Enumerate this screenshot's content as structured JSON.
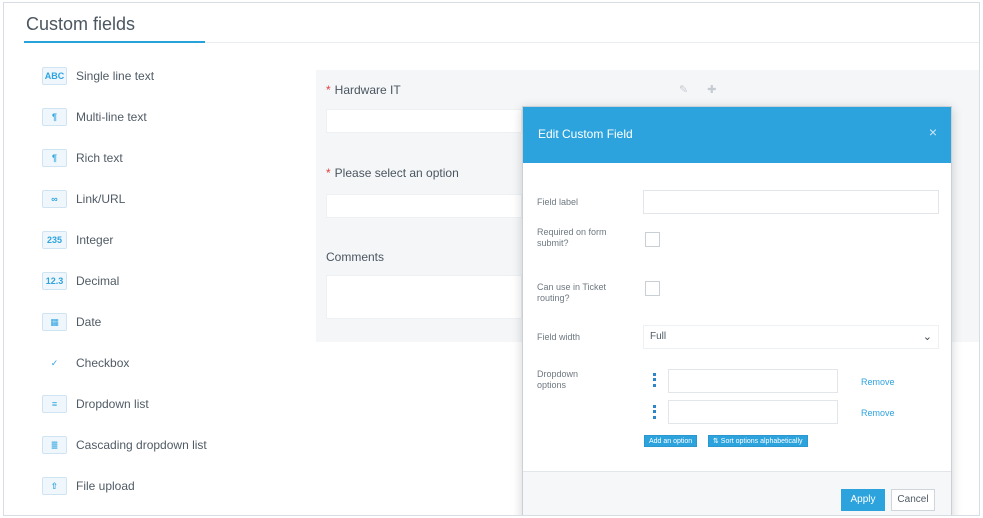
{
  "header": {
    "title": "Custom fields"
  },
  "palette": {
    "items": [
      {
        "icon_text": "ABC",
        "label": "Single line text"
      },
      {
        "icon_text": "¶",
        "label": "Multi-line text"
      },
      {
        "icon_text": "¶",
        "label": "Rich text"
      },
      {
        "icon_text": "∞",
        "label": "Link/URL"
      },
      {
        "icon_text": "235",
        "label": "Integer"
      },
      {
        "icon_text": "12.3",
        "label": "Decimal"
      },
      {
        "icon_text": "▦",
        "label": "Date"
      },
      {
        "icon_text": "✓",
        "label": "Checkbox"
      },
      {
        "icon_text": "≡",
        "label": "Dropdown list"
      },
      {
        "icon_text": "≣",
        "label": "Cascading dropdown list"
      },
      {
        "icon_text": "⇧",
        "label": "File upload"
      }
    ]
  },
  "form": {
    "fields": [
      {
        "label": "Hardware IT",
        "required": "*"
      },
      {
        "label": "Please select an option",
        "required": "*"
      },
      {
        "label": "Comments",
        "required": ""
      }
    ],
    "tool_icons": "✎ ✚"
  },
  "modal": {
    "title": "Edit Custom Field",
    "close": "×",
    "field_label": "Field label",
    "required_label": "Required on form submit?",
    "routing_label": "Can use in Ticket routing?",
    "width_label": "Field width",
    "width_value": "Full",
    "width_arrow": "⌄",
    "options_label": "Dropdown options",
    "remove": "Remove",
    "add_option": "Add an option",
    "sort_options": "⇅ Sort options alphabetically",
    "apply": "Apply",
    "cancel": "Cancel"
  }
}
